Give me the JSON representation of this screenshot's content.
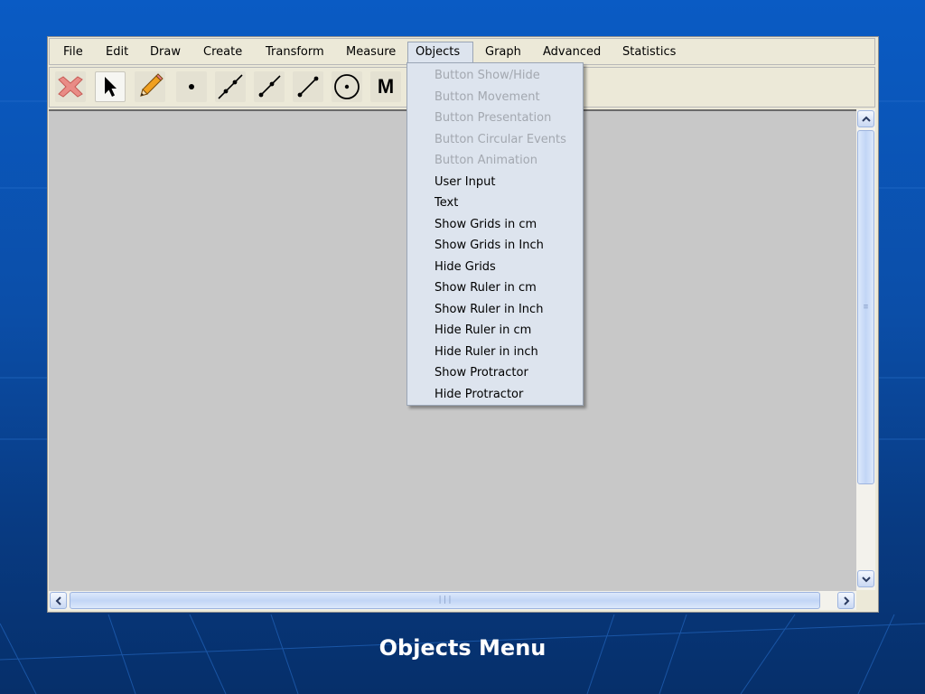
{
  "menubar": {
    "items": [
      "File",
      "Edit",
      "Draw",
      "Create",
      "Transform",
      "Measure",
      "Objects",
      "Graph",
      "Advanced",
      "Statistics"
    ],
    "active": "Objects"
  },
  "toolbar": {
    "tools": [
      {
        "icon": "delete-x-icon"
      },
      {
        "icon": "arrow-pointer-icon",
        "selected": true
      },
      {
        "icon": "pencil-icon"
      },
      {
        "icon": "point-icon"
      },
      {
        "icon": "line-icon"
      },
      {
        "icon": "segment-icon"
      },
      {
        "icon": "ray-icon"
      },
      {
        "icon": "circle-icon"
      },
      {
        "icon": "macro-icon",
        "label": "M"
      }
    ]
  },
  "objects_menu": {
    "items": [
      {
        "label": "Button Show/Hide",
        "enabled": false
      },
      {
        "label": "Button Movement",
        "enabled": false
      },
      {
        "label": "Button Presentation",
        "enabled": false
      },
      {
        "label": "Button Circular Events",
        "enabled": false
      },
      {
        "label": "Button Animation",
        "enabled": false
      },
      {
        "label": "User Input",
        "enabled": true
      },
      {
        "label": "Text",
        "enabled": true
      },
      {
        "label": "Show Grids in cm",
        "enabled": true
      },
      {
        "label": "Show Grids in Inch",
        "enabled": true
      },
      {
        "label": "Hide Grids",
        "enabled": true
      },
      {
        "label": "Show Ruler in cm",
        "enabled": true
      },
      {
        "label": "Show Ruler in Inch",
        "enabled": true
      },
      {
        "label": "Hide Ruler in cm",
        "enabled": true
      },
      {
        "label": "Hide Ruler in inch",
        "enabled": true
      },
      {
        "label": "Show Protractor",
        "enabled": true
      },
      {
        "label": "Hide Protractor",
        "enabled": true
      }
    ]
  },
  "caption": "Objects Menu",
  "colors": {
    "menu_bg": "#dde4ee",
    "disabled_text": "#a3a8b0",
    "canvas": "#c8c8c8",
    "window": "#ece9d8"
  }
}
